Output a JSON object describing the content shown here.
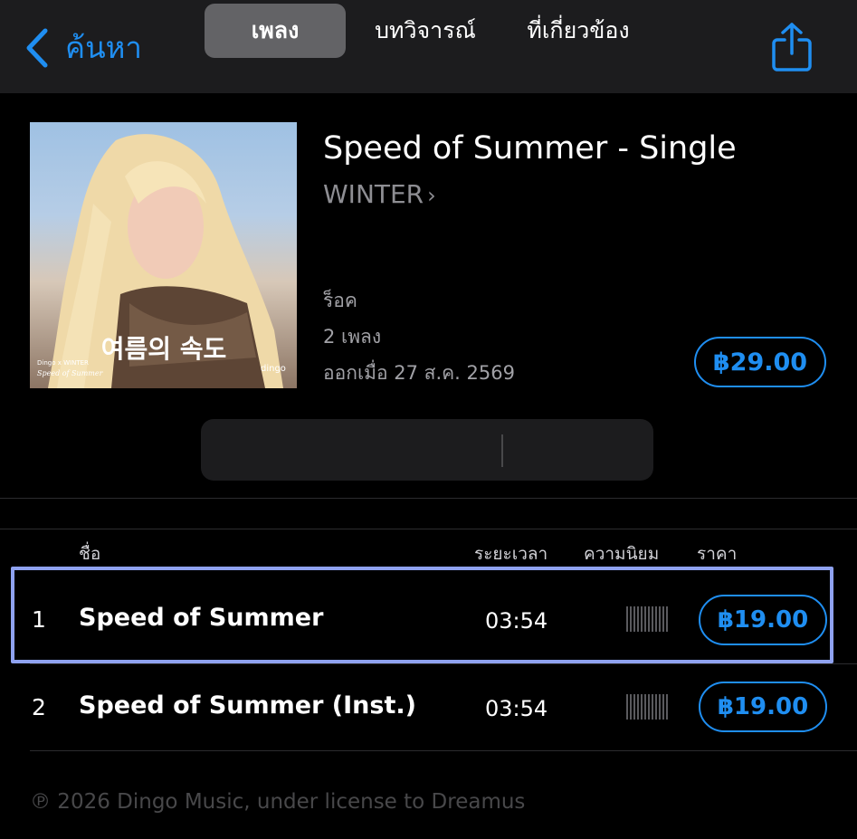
{
  "nav": {
    "back_label": "ค้นหา"
  },
  "album": {
    "title": "Speed of Summer - Single",
    "artist": "WINTER",
    "genre": "ร็อค",
    "track_count": "2 เพลง",
    "release": "ออกเมื่อ 27 ส.ค. 2569",
    "price": "฿29.00",
    "cover_text": "여름의 속도",
    "cover_small_text": "Dingo x WINTER",
    "cover_small_text2": "Speed of Summer",
    "cover_label": "dingo"
  },
  "segments": [
    {
      "label": "เพลง",
      "active": true
    },
    {
      "label": "บทวิจารณ์",
      "active": false
    },
    {
      "label": "ที่เกี่ยวข้อง",
      "active": false
    }
  ],
  "columns": {
    "name": "ชื่อ",
    "duration": "ระยะเวลา",
    "popularity": "ความนิยม",
    "price": "ราคา"
  },
  "tracks": [
    {
      "num": "1",
      "title": "Speed of Summer",
      "duration": "03:54",
      "price": "฿19.00"
    },
    {
      "num": "2",
      "title": "Speed of Summer (Inst.)",
      "duration": "03:54",
      "price": "฿19.00"
    }
  ],
  "copyright": "℗ 2026 Dingo Music, under license to Dreamus",
  "colors": {
    "accent": "#1f8ef1",
    "highlight": "#8fa2f0",
    "navbar": "#1c1c1e"
  }
}
